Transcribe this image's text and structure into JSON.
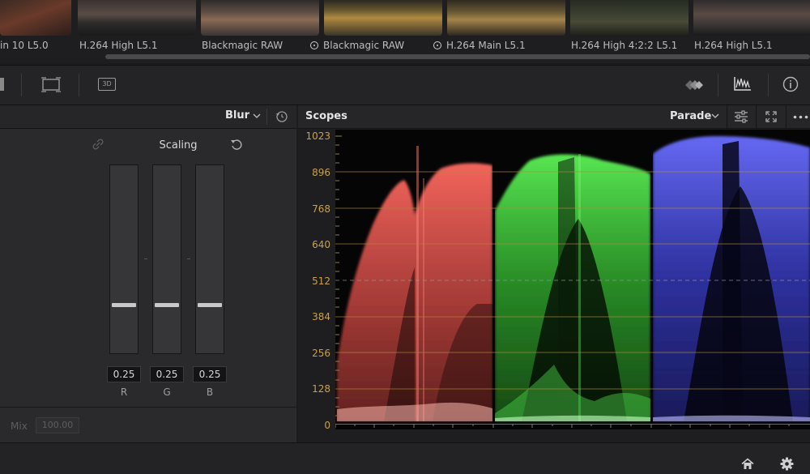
{
  "thumbnails": [
    {
      "label": "in 10 L5.0",
      "icon": ""
    },
    {
      "label": "H.264 High L5.1",
      "icon": ""
    },
    {
      "label": "Blackmagic RAW",
      "icon": ""
    },
    {
      "label": "Blackmagic RAW",
      "icon": "braw-icon"
    },
    {
      "label": "H.264 Main L5.1",
      "icon": "braw-icon"
    },
    {
      "label": "H.264 High 4:2:2 L5.1",
      "icon": ""
    },
    {
      "label": "H.264 High L5.1",
      "icon": ""
    }
  ],
  "toolbar": {
    "three_d_label": "3D"
  },
  "left_panel": {
    "mode_label": "Blur",
    "section_title": "Scaling",
    "channels": [
      {
        "name": "R",
        "value": "0.25",
        "level": 0.25
      },
      {
        "name": "G",
        "value": "0.25",
        "level": 0.25
      },
      {
        "name": "B",
        "value": "0.25",
        "level": 0.25
      }
    ],
    "mix_label": "Mix",
    "mix_value": "100.00"
  },
  "scopes": {
    "title": "Scopes",
    "mode": "Parade",
    "y_ticks": [
      "1023",
      "896",
      "768",
      "640",
      "512",
      "384",
      "256",
      "128",
      "0"
    ],
    "colors": {
      "red": "#e05a55",
      "green": "#4ed44a",
      "blue": "#4a4ee8",
      "tick": "#c8a050"
    }
  }
}
